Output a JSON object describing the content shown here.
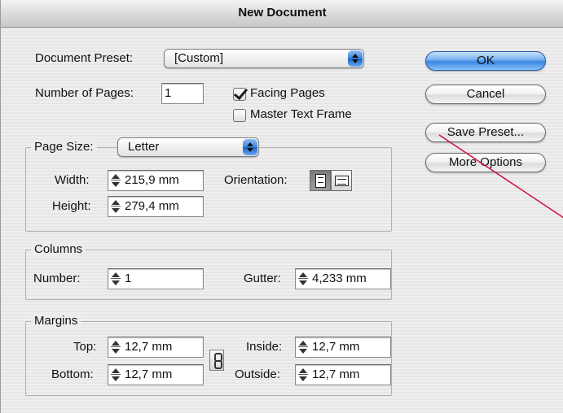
{
  "window": {
    "title": "New Document"
  },
  "document_preset": {
    "label": "Document Preset:",
    "value": "[Custom]"
  },
  "pages": {
    "label": "Number of Pages:",
    "value": "1"
  },
  "facing_pages": {
    "label": "Facing Pages",
    "checked": true
  },
  "master_text_frame": {
    "label": "Master Text Frame",
    "checked": false
  },
  "page_size": {
    "label": "Page Size:",
    "value": "Letter",
    "width_label": "Width:",
    "width": "215,9 mm",
    "height_label": "Height:",
    "height": "279,4 mm",
    "orientation_label": "Orientation:",
    "orientation": "portrait"
  },
  "columns": {
    "title": "Columns",
    "number_label": "Number:",
    "number": "1",
    "gutter_label": "Gutter:",
    "gutter": "4,233 mm"
  },
  "margins": {
    "title": "Margins",
    "top_label": "Top:",
    "top": "12,7 mm",
    "bottom_label": "Bottom:",
    "bottom": "12,7 mm",
    "inside_label": "Inside:",
    "inside": "12,7 mm",
    "outside_label": "Outside:",
    "outside": "12,7 mm"
  },
  "buttons": {
    "ok": "OK",
    "cancel": "Cancel",
    "save_preset": "Save Preset...",
    "more_options": "More Options"
  },
  "annotation": {
    "color": "#d01040"
  }
}
